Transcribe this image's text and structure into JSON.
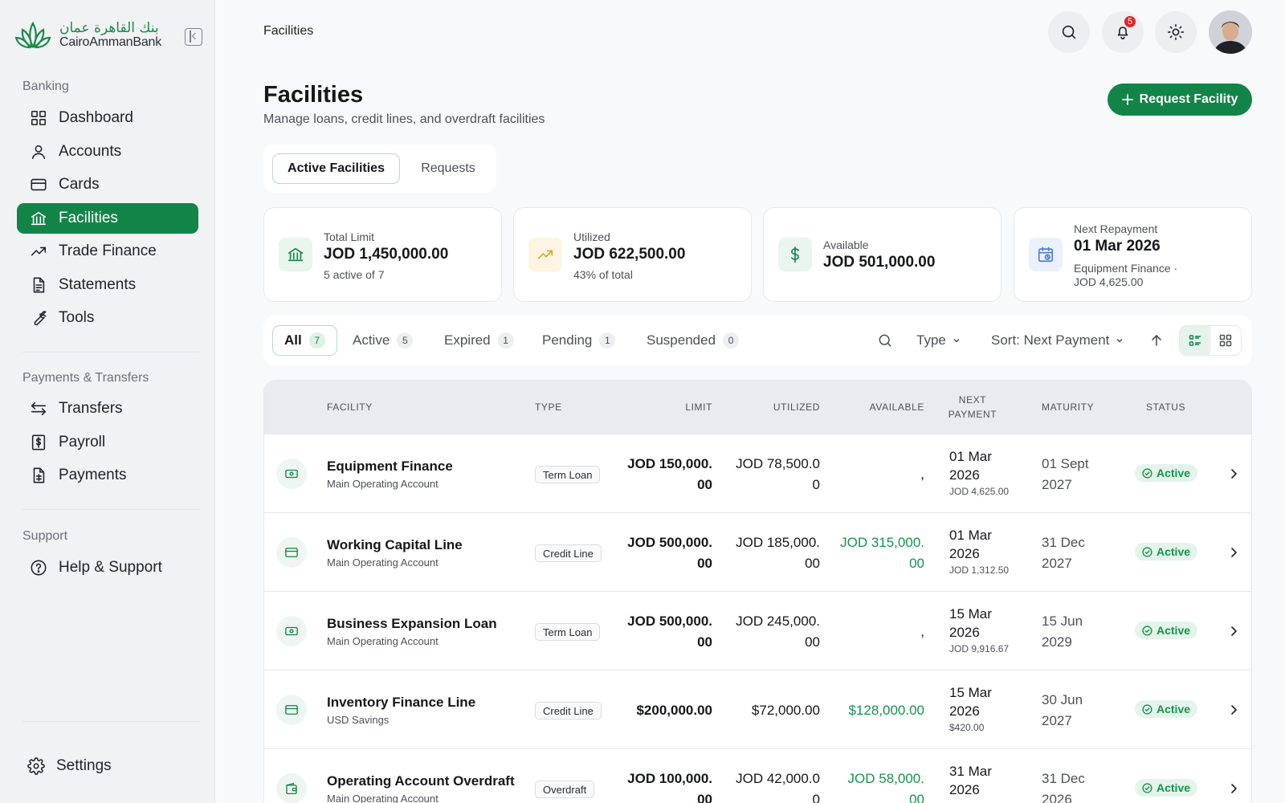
{
  "brand": {
    "arabic": "بنك القاهرة عمان",
    "english": "CairoAmmanBank",
    "color": "#128447"
  },
  "sidebar": {
    "sections": [
      {
        "heading": "Banking",
        "items": [
          {
            "label": "Dashboard",
            "icon": "grid-icon"
          },
          {
            "label": "Accounts",
            "icon": "user-icon"
          },
          {
            "label": "Cards",
            "icon": "card-icon"
          },
          {
            "label": "Facilities",
            "icon": "bank-icon",
            "active": true
          },
          {
            "label": "Trade Finance",
            "icon": "trend-icon"
          },
          {
            "label": "Statements",
            "icon": "document-icon"
          },
          {
            "label": "Tools",
            "icon": "wrench-icon"
          }
        ]
      },
      {
        "heading": "Payments & Transfers",
        "items": [
          {
            "label": "Transfers",
            "icon": "swap-icon"
          },
          {
            "label": "Payroll",
            "icon": "payroll-icon"
          },
          {
            "label": "Payments",
            "icon": "receipt-icon"
          }
        ]
      },
      {
        "heading": "Support",
        "items": [
          {
            "label": "Help & Support",
            "icon": "help-icon"
          }
        ]
      }
    ],
    "settings_label": "Settings"
  },
  "topbar": {
    "breadcrumb": "Facilities",
    "notifications_count": "5"
  },
  "header": {
    "title": "Facilities",
    "subtitle": "Manage loans, credit lines, and overdraft facilities",
    "request_button": "Request Facility"
  },
  "tabs": [
    {
      "label": "Active Facilities",
      "active": true
    },
    {
      "label": "Requests",
      "active": false
    }
  ],
  "stats": [
    {
      "label": "Total Limit",
      "value": "JOD 1,450,000.00",
      "note": "5 active of 7",
      "icon": "bank-icon",
      "tint": "#e9f5ee",
      "icon_color": "#128447"
    },
    {
      "label": "Utilized",
      "value": "JOD 622,500.00",
      "note": "43% of total",
      "icon": "trend-icon",
      "tint": "#fdf5e2",
      "icon_color": "#e3a321"
    },
    {
      "label": "Available",
      "value": "JOD 501,000.00",
      "note": "",
      "icon": "dollar-icon",
      "tint": "#e9f5ee",
      "icon_color": "#128447"
    },
    {
      "label": "Next Repayment",
      "value": "01 Mar 2026",
      "note": "Equipment Finance ·\nJOD 4,625.00",
      "icon": "calendar-icon",
      "tint": "#eaf1fb",
      "icon_color": "#4b7fcf"
    }
  ],
  "filters": {
    "chips": [
      {
        "label": "All",
        "count": "7",
        "active": true
      },
      {
        "label": "Active",
        "count": "5"
      },
      {
        "label": "Expired",
        "count": "1"
      },
      {
        "label": "Pending",
        "count": "1"
      },
      {
        "label": "Suspended",
        "count": "0"
      }
    ],
    "type_label": "Type",
    "sort_label": "Sort: Next Payment"
  },
  "table": {
    "columns": [
      "Facility",
      "Type",
      "Limit",
      "Utilized",
      "Available",
      "Next\nPayment",
      "Maturity",
      "Status"
    ],
    "rows": [
      {
        "name": "Equipment Finance",
        "account": "Main Operating Account",
        "type": "Term Loan",
        "icon": "cash-icon",
        "limit": "JOD 150,000.\n00",
        "utilized": "JOD 78,500.0\n0",
        "available": ",",
        "available_green": false,
        "next_date": "01 Mar\n2026",
        "next_amount": "JOD 4,625.00",
        "maturity": "01 Sept\n2027",
        "status": "Active"
      },
      {
        "name": "Working Capital Line",
        "account": "Main Operating Account",
        "type": "Credit Line",
        "icon": "card-icon",
        "limit": "JOD 500,000.\n00",
        "utilized": "JOD 185,000.\n00",
        "available": "JOD 315,000.\n00",
        "available_green": true,
        "next_date": "01 Mar\n2026",
        "next_amount": "JOD 1,312.50",
        "maturity": "31 Dec\n2027",
        "status": "Active"
      },
      {
        "name": "Business Expansion Loan",
        "account": "Main Operating Account",
        "type": "Term Loan",
        "icon": "cash-icon",
        "limit": "JOD 500,000.\n00",
        "utilized": "JOD 245,000.\n00",
        "available": ",",
        "available_green": false,
        "next_date": "15 Mar\n2026",
        "next_amount": "JOD 9,916.67",
        "maturity": "15 Jun\n2029",
        "status": "Active"
      },
      {
        "name": "Inventory Finance Line",
        "account": "USD Savings",
        "type": "Credit Line",
        "icon": "card-icon",
        "limit": "$200,000.00",
        "utilized": "$72,000.00",
        "available": "$128,000.00",
        "available_green": true,
        "next_date": "15 Mar\n2026",
        "next_amount": "$420.00",
        "maturity": "30 Jun\n2027",
        "status": "Active"
      },
      {
        "name": "Operating Account Overdraft",
        "account": "Main Operating Account",
        "type": "Overdraft",
        "icon": "wallet-icon",
        "limit": "JOD 100,000.\n00",
        "utilized": "JOD 42,000.0\n0",
        "available": "JOD 58,000.\n00",
        "available_green": true,
        "next_date": "31 Mar\n2026",
        "next_amount": "",
        "maturity": "31 Dec\n2026",
        "status": "Active"
      }
    ]
  }
}
